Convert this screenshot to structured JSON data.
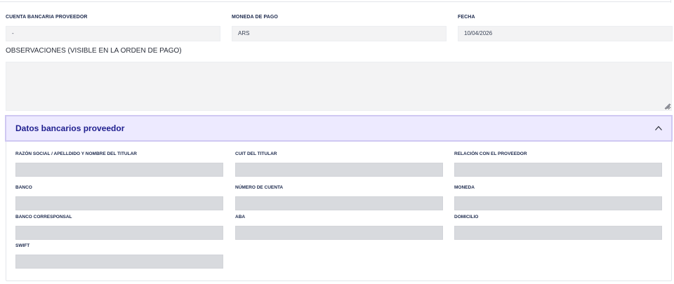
{
  "form": {
    "cuenta_bancaria": {
      "label": "CUENTA BANCARIA PROVEEDOR",
      "value": "-"
    },
    "moneda_pago": {
      "label": "MONEDA DE PAGO",
      "value": "ARS"
    },
    "fecha": {
      "label": "FECHA",
      "value": "10/04/2026"
    },
    "observaciones": {
      "label": "OBSERVACIONES (VISIBLE EN LA ORDEN DE PAGO)",
      "value": ""
    }
  },
  "bank_section": {
    "title": "Datos bancarios proveedor",
    "expanded": true,
    "fields": {
      "razon_social": {
        "label": "RAZÓN SOCIAL / APELLDIDO Y NOMBRE DEL TITULAR",
        "value": ""
      },
      "cuit": {
        "label": "CUIT DEL TITULAR",
        "value": ""
      },
      "relacion": {
        "label": "RELACIÓN CON EL PROVEEDOR",
        "value": ""
      },
      "banco": {
        "label": "BANCO",
        "value": ""
      },
      "numero_cuenta": {
        "label": "NÚMERO DE CUENTA",
        "value": ""
      },
      "moneda": {
        "label": "MONEDA",
        "value": ""
      },
      "banco_corresponsal": {
        "label": "BANCO CORRESPONSAL",
        "value": ""
      },
      "aba": {
        "label": "ABA",
        "value": ""
      },
      "domicilio": {
        "label": "DOMICILIO",
        "value": ""
      },
      "swift": {
        "label": "SWIFT",
        "value": ""
      }
    }
  },
  "icons": {
    "collapse": "chevron-up-icon",
    "resize": "resize-grip-icon"
  },
  "colors": {
    "header_bg": "#edeaff",
    "header_border": "#cfc8f2",
    "title": "#1f1f8f",
    "field_bg": "#f3f3f4",
    "disabled_field": "#d8dade"
  }
}
